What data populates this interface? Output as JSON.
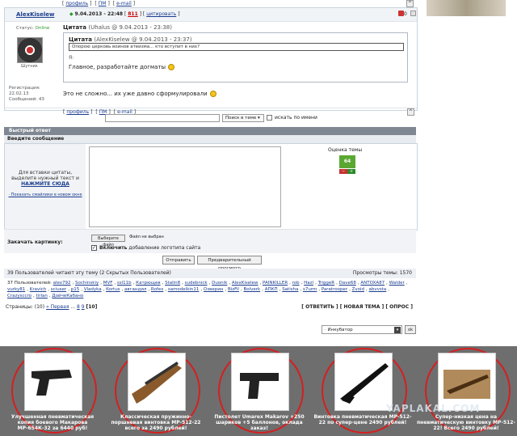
{
  "post_links": {
    "profile": "профиль",
    "pm": "ПМ",
    "email": "e-mail",
    "sep_open": "[",
    "sep_close": "]"
  },
  "post": {
    "author": "AlexKiselew",
    "date": "9.04.2013 - 22:48",
    "number": "811",
    "quote_link": "цитировать",
    "count": "0",
    "status_label": "Статус:",
    "status_value": "Online",
    "avatar_label": "Шутник",
    "reg_line1": "Регистрация: 22.02.13",
    "reg_line2": "Сообщений: 43",
    "quote_title": "Цитата",
    "quote_meta": "(Uhalus @ 9.04.2013 - 23:38)",
    "inner_quote_title": "Цитата",
    "inner_quote_meta": "(AlexKiselew @ 9.04.2013 - 23:37)",
    "inner_quote_text": "Опорою церковь воинов атеизма... кто вступит в них?",
    "quote_text1": "Я:",
    "quote_text2": "Главное, разработайте догматы",
    "post_text": "Это не сложно... их уже давно сформулировали"
  },
  "search": {
    "select_label": "Поиск в теме ▾",
    "checkbox_label": "искать по имени"
  },
  "quick_reply": {
    "header": "Быстрый ответ",
    "sub_header": "Введите сообщение",
    "left_text1": "Для вставки цитаты,",
    "left_text2": "выделите нужный текст и",
    "left_text3": "НАЖМИТЕ СЮДА",
    "left_link": "· Показать смайлики в новом окне",
    "rating_title": "Оценка темы",
    "rating_value": "64",
    "rating_minus": "−",
    "rating_plus": "+",
    "picture_label": "Закачать картинку:",
    "file_button": "Выберите файл",
    "file_none": "Файл не выбран",
    "logo_check": "✓",
    "logo_label_bold": "Включить",
    "logo_label": "добавление логотипа сайта",
    "send_button": "Отправить",
    "preview_button": "Предварительный просмотр"
  },
  "readers": {
    "text": "39 Пользователей читают эту тему (2 Скрытых Пользователей)",
    "views": "Просмотры темы: 1570"
  },
  "users": {
    "prefix": "37 Пользователей:",
    "names": [
      "alex792",
      "Sochinskiy",
      "MVF",
      "ssl11b",
      "Катрющев",
      "Stalin8",
      "sudebnick",
      "Duonik",
      "AlexKiselew",
      "PAINKILLER",
      "rob",
      "Hazl",
      "TriggeR",
      "Dave68",
      "ANTOXA87",
      "Walder",
      "vurky81",
      "Kravich",
      "sciuser",
      "p15",
      "Vladyka",
      "Kortus",
      "авгандил",
      "Rofex",
      "samodelkin11",
      "Озверин",
      "BizFil",
      "Bolverk",
      "АПКП",
      "Satisha",
      "s7urm",
      "Paratrooper",
      "Zvoid",
      "abvvsta",
      "Crazysccro",
      "tirlan",
      "ДойчеКабано"
    ]
  },
  "pager": {
    "label": "Страницы:",
    "total": "(10)",
    "first": "« Первая",
    "dots": "...",
    "p8": "8",
    "p9": "9",
    "current": "[10]",
    "reply": "[ ОТВЕТИТЬ ]",
    "new_topic": "[ НОВАЯ ТЕМА ]",
    "poll": "[ ОПРОС ]"
  },
  "forum_select": {
    "value": "· Инкубатор",
    "arrow": "▾",
    "ok": "ok"
  },
  "up_arrow": "^",
  "ads": [
    {
      "text": "Улучшенная пневматическая копия боевого Макарова МР-654К-32 за 6440 руб!"
    },
    {
      "text": "Классическая пружинно-поршневая винтовка МР-512-22 всего за 2490 рублей!"
    },
    {
      "text": "Пистолет Umarex Makarov +250 шариков +5 баллонов, оклада заказ!"
    },
    {
      "text": "Винтовка пневматическая МР-512-22 по супер-цене 2490 рублей!"
    },
    {
      "text": "Супер-низкая цена на пневматическую винтовку МР-512-22! Всего 2490 рублей!"
    }
  ],
  "watermark": "YAPLAKAL.COM"
}
